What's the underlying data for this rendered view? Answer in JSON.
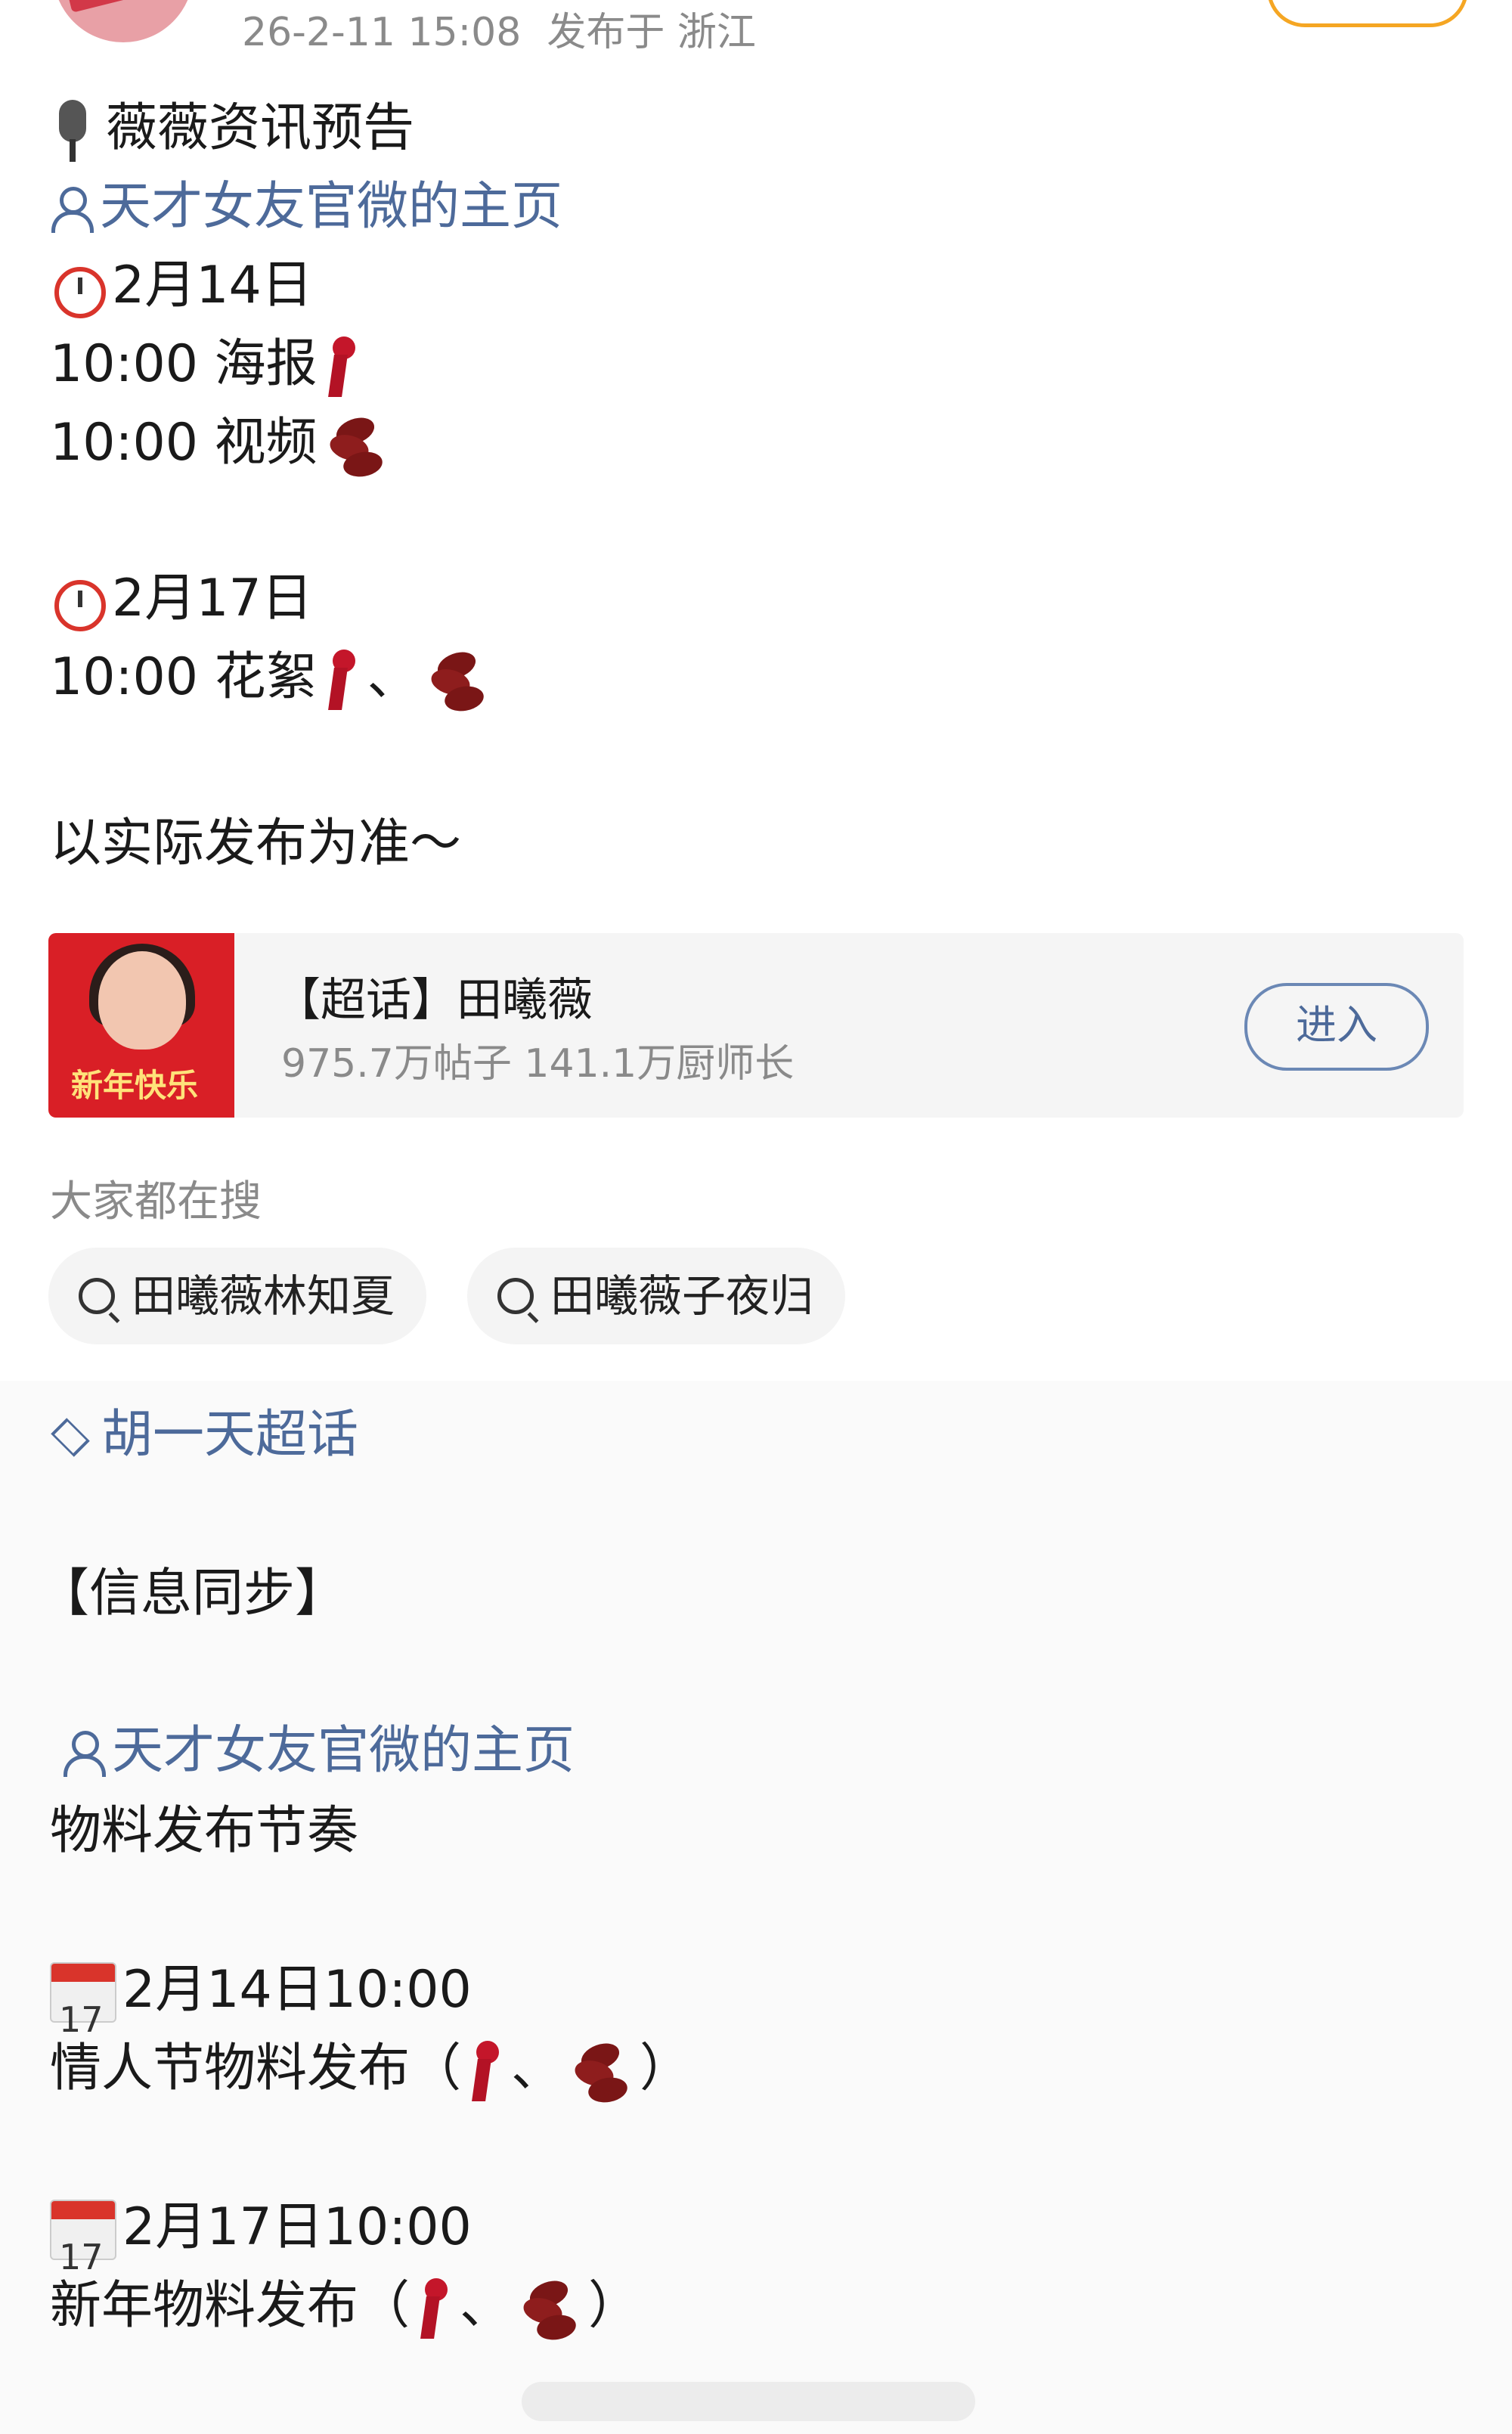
{
  "post_meta": {
    "time": "26-2-11 15:08",
    "location": "发布于 浙江"
  },
  "post": {
    "title": "薇薇资讯预告",
    "mention": "天才女友官微的主页",
    "schedule": [
      {
        "date": "2月14日",
        "items": [
          "10:00 海报",
          "10:00 视频"
        ]
      },
      {
        "date": "2月17日",
        "items": [
          "10:00 花絮"
        ]
      }
    ],
    "sep": "、",
    "note": "以实际发布为准～"
  },
  "topic_card": {
    "badge": "新年快乐",
    "title": "【超话】田曦薇",
    "stats": "975.7万帖子 141.1万厨师长",
    "enter": "进入"
  },
  "search": {
    "label": "大家都在搜",
    "chips": [
      "田曦薇林知夏",
      "田曦薇子夜归"
    ]
  },
  "repost": {
    "topic": "胡一天超话",
    "header": "【信息同步】",
    "mention": "天才女友官微的主页",
    "subtitle": "物料发布节奏",
    "cal_day": "17",
    "events": [
      {
        "datetime": "2月14日10:00",
        "desc": "情人节物料发布（",
        "close": "）"
      },
      {
        "datetime": "2月17日10:00",
        "desc": "新年物料发布（",
        "close": "）"
      }
    ]
  },
  "icons": [
    "microphone-icon",
    "person-icon",
    "alarm-clock-icon",
    "scarf-icon",
    "beans-icon",
    "search-icon",
    "diamond-icon",
    "calendar-icon"
  ],
  "colors": {
    "link": "#4d6a9a",
    "meta": "#8a8a8a",
    "follow": "#f5a623"
  }
}
